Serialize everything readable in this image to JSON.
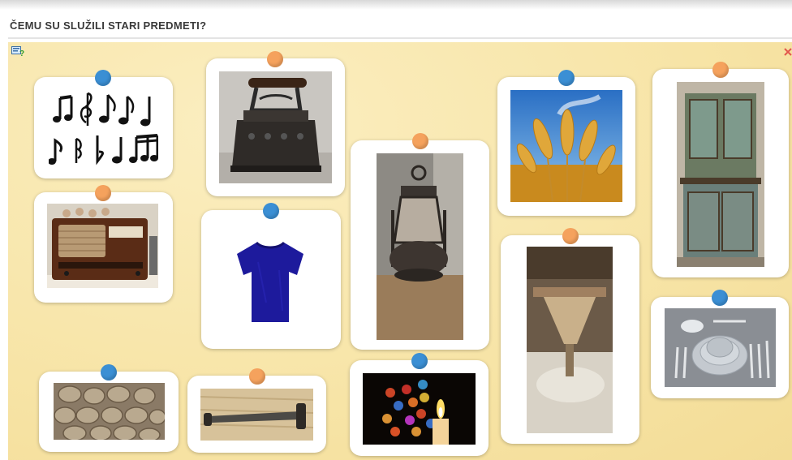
{
  "page": {
    "title": "ČEMU SU SLUŽILI STARI PREDMETI?"
  },
  "toolbar": {
    "help_icon": "help-icon",
    "close_icon": "close-icon"
  },
  "colors": {
    "pin_blue": "#3b8fd4",
    "pin_orange": "#f5a25d",
    "board": "#f7e4a6"
  },
  "cards": [
    {
      "id": "music-notes",
      "pin": "blue"
    },
    {
      "id": "old-iron",
      "pin": "orange"
    },
    {
      "id": "wheat",
      "pin": "blue"
    },
    {
      "id": "old-cupboard",
      "pin": "orange"
    },
    {
      "id": "old-radio",
      "pin": "orange"
    },
    {
      "id": "blue-tshirt",
      "pin": "blue"
    },
    {
      "id": "oil-lantern",
      "pin": "orange"
    },
    {
      "id": "mill-hopper",
      "pin": "orange"
    },
    {
      "id": "table-setting",
      "pin": "blue"
    },
    {
      "id": "firewood-logs",
      "pin": "blue"
    },
    {
      "id": "old-saw",
      "pin": "orange"
    },
    {
      "id": "candle-lights",
      "pin": "blue"
    }
  ]
}
